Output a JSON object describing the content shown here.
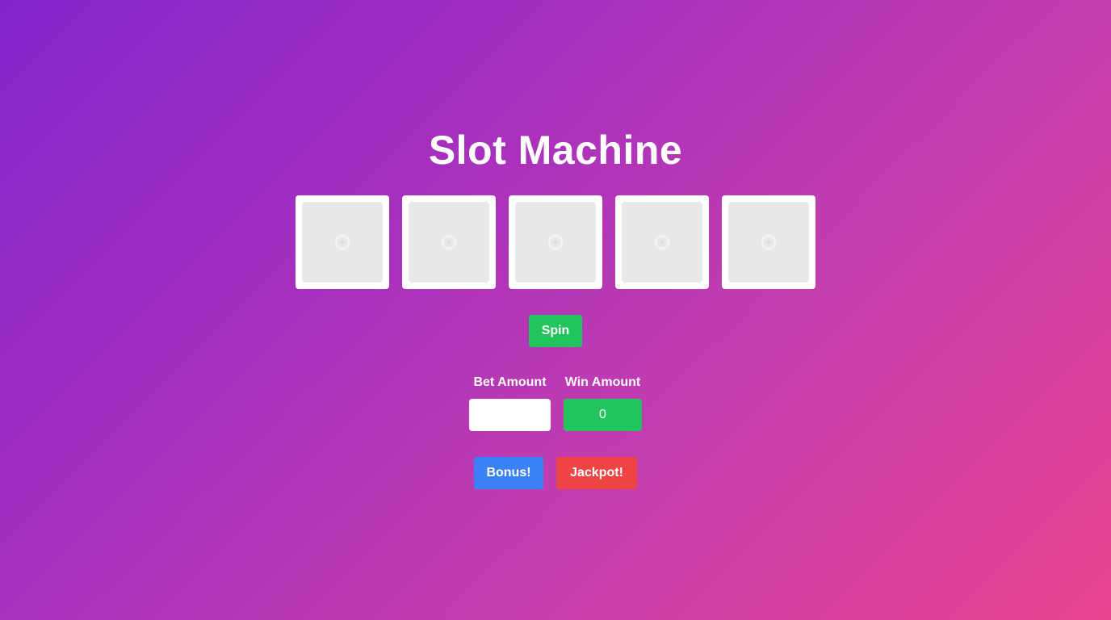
{
  "title": "Slot Machine",
  "reels": [
    {
      "icon": "loading-spinner-icon"
    },
    {
      "icon": "loading-spinner-icon"
    },
    {
      "icon": "loading-spinner-icon"
    },
    {
      "icon": "loading-spinner-icon"
    },
    {
      "icon": "loading-spinner-icon"
    }
  ],
  "controls": {
    "spin_label": "Spin",
    "bet_label": "Bet Amount",
    "bet_value": "",
    "win_label": "Win Amount",
    "win_value": "0",
    "bonus_label": "Bonus!",
    "jackpot_label": "Jackpot!"
  },
  "colors": {
    "spin_button": "#22c45d",
    "win_box": "#22c45d",
    "bonus_button": "#3b82f6",
    "jackpot_button": "#ef4444",
    "reel_frame": "#ffffff",
    "reel_inner": "#e8e8e8"
  }
}
